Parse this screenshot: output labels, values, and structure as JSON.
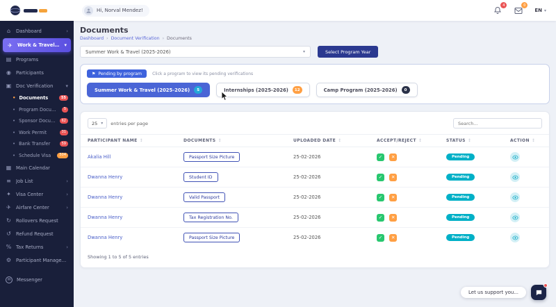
{
  "header": {
    "greeting": "Hi, Norval Mendez!",
    "notification_count": "4",
    "secondary_count": "0",
    "language": "EN"
  },
  "sidebar": {
    "items": [
      {
        "label": "Dashboard",
        "icon": "⌂"
      },
      {
        "label": "Work & Travel Sys.",
        "icon": "✈"
      },
      {
        "label": "Programs",
        "icon": "▤"
      },
      {
        "label": "Participants",
        "icon": "◉"
      },
      {
        "label": "Doc Verification",
        "icon": "▣"
      },
      {
        "label": "Documents",
        "badge": "55"
      },
      {
        "label": "Program Documents",
        "badge": "5"
      },
      {
        "label": "Sponsor Documents",
        "badge": "62"
      },
      {
        "label": "Work Permit",
        "badge": "31"
      },
      {
        "label": "Bank Transfer",
        "badge": "59"
      },
      {
        "label": "Schedule Visa",
        "badge": "504"
      },
      {
        "label": "Main Calendar",
        "icon": "▦"
      },
      {
        "label": "Job List",
        "icon": "≡"
      },
      {
        "label": "Visa Center",
        "icon": "✦"
      },
      {
        "label": "Airfare Center",
        "icon": "✈"
      },
      {
        "label": "Rollovers Request",
        "icon": "↻"
      },
      {
        "label": "Refund Request",
        "icon": "↺"
      },
      {
        "label": "Tax Returns",
        "icon": "%"
      },
      {
        "label": "Participant Management",
        "icon": "⚙"
      },
      {
        "label": "Messenger",
        "icon": "✉"
      }
    ]
  },
  "page": {
    "title": "Documents",
    "breadcrumb": [
      "Dashboard",
      "Document Verification",
      "Documents"
    ],
    "program_select_value": "Summer Work & Travel (2025-2026)",
    "select_year_button": "Select Program Year"
  },
  "pending_panel": {
    "button_label": "Pending by program",
    "hint": "Click a program to view its pending verifications",
    "tabs": [
      {
        "label": "Summer Work & Travel (2025-2026)",
        "badge": "5"
      },
      {
        "label": "Internships (2025-2026)",
        "badge": "12"
      },
      {
        "label": "Camp Program (2025-2026)",
        "badge": "0"
      }
    ]
  },
  "table": {
    "entries_per_page": "25",
    "entries_label": "entries per page",
    "search_placeholder": "Search...",
    "columns": [
      "PARTICIPANT NAME",
      "DOCUMENTS",
      "UPLOADED DATE",
      "ACCEPT/REJECT",
      "STATUS",
      "ACTION"
    ],
    "rows": [
      {
        "name": "Akalia Hill",
        "document": "Passport Size Picture",
        "date": "25-02-2026",
        "status": "Pending"
      },
      {
        "name": "Dwanna Henry",
        "document": "Student ID",
        "date": "25-02-2026",
        "status": "Pending"
      },
      {
        "name": "Dwanna Henry",
        "document": "Valid Passport",
        "date": "25-02-2026",
        "status": "Pending"
      },
      {
        "name": "Dwanna Henry",
        "document": "Tax Registration No.",
        "date": "25-02-2026",
        "status": "Pending"
      },
      {
        "name": "Dwanna Henry",
        "document": "Passport Size Picture",
        "date": "25-02-2026",
        "status": "Pending"
      }
    ],
    "footer": "Showing 1 to 5 of 5 entries"
  },
  "chat": {
    "label": "Let us support you..."
  },
  "icons": {
    "chevron_right": "›",
    "chevron_down": "▾",
    "flag": "⚑",
    "check": "✓",
    "cross": "✕",
    "sort": "↕",
    "dot": "•"
  },
  "colors": {
    "sidebar_bg": "#191f3a",
    "active_purple": "#5a4fe0",
    "accent_blue": "#3e63dd",
    "primary_navy": "#2b3990",
    "success_green": "#28c76f",
    "warning_orange": "#ff9f43",
    "info_teal": "#00b0c7",
    "danger_red": "#ea5455"
  }
}
